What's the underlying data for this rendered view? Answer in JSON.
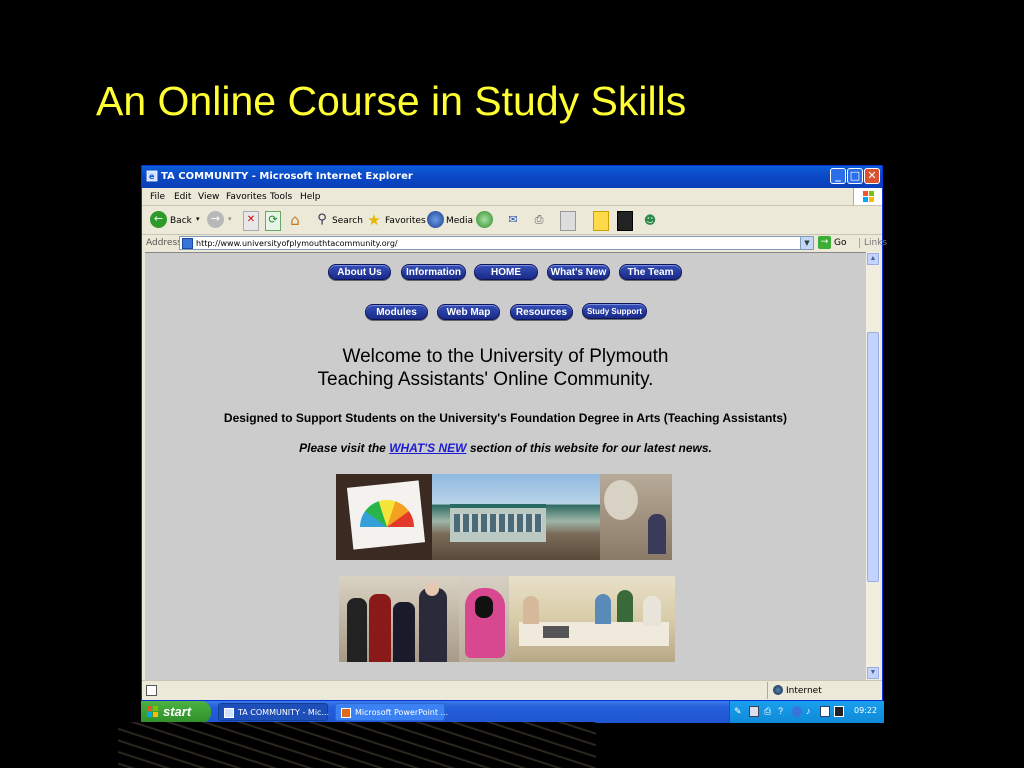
{
  "slide": {
    "title": "An Online Course in Study Skills"
  },
  "window": {
    "title": "TA COMMUNITY - Microsoft Internet Explorer",
    "controls": {
      "minimize": "_",
      "maximize": "□",
      "close": "✕"
    },
    "menu": [
      "File",
      "Edit",
      "View",
      "Favorites",
      "Tools",
      "Help"
    ],
    "toolbar": {
      "back": "Back",
      "search": "Search",
      "favorites": "Favorites",
      "media": "Media"
    },
    "address": {
      "label": "Address",
      "url": "http://www.universityofplymouthtacommunity.org/",
      "go": "Go",
      "links": "Links"
    },
    "status": {
      "zone": "Internet"
    }
  },
  "page": {
    "nav_row1": [
      "About Us",
      "Information",
      "HOME",
      "What's New",
      "The Team"
    ],
    "nav_row2": [
      "Modules",
      "Web Map",
      "Resources",
      "Study Support"
    ],
    "welcome_line1": "Welcome to the University of Plymouth",
    "welcome_line2": "Teaching Assistants' Online Community.",
    "designed": "Designed to Support Students on the University's Foundation Degree in Arts (Teaching Assistants)",
    "visit_prefix": "Please visit the",
    "visit_link": "WHAT'S NEW",
    "visit_suffix": "section of this website for our latest news."
  },
  "taskbar": {
    "start": "start",
    "tasks": [
      "TA COMMUNITY - Mic...",
      "Microsoft PowerPoint ..."
    ],
    "clock": "09:22"
  },
  "colors": {
    "title_yellow": "#ffff33",
    "xp_blue": "#0a5fd8",
    "nav_button": "#1a2a88",
    "page_bg": "#cccccc"
  }
}
